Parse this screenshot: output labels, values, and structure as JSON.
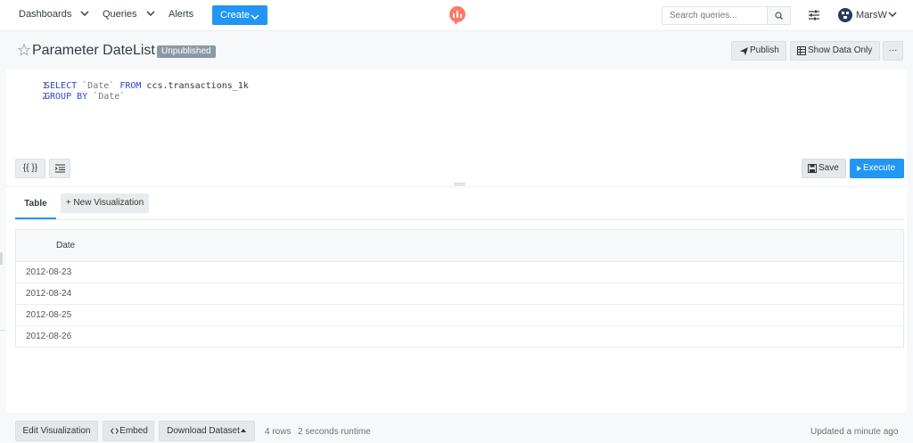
{
  "nav": {
    "dashboards": "Dashboards",
    "queries": "Queries",
    "alerts": "Alerts",
    "create": "Create",
    "search_placeholder": "Search queries...",
    "username": "MarsW"
  },
  "query": {
    "title": "Parameter DateList",
    "status_badge": "Unpublished",
    "publish_label": "Publish",
    "show_data_only_label": "Show Data Only",
    "more_label": "···"
  },
  "editor": {
    "lines": [
      {
        "num": "1",
        "tokens": [
          "SELECT",
          " ",
          "`Date`",
          " ",
          "FROM",
          " ccs.transactions_1k"
        ]
      },
      {
        "num": "2",
        "tokens": [
          "GROUP BY",
          " ",
          "`Date`"
        ]
      }
    ],
    "params_label": "{{ }}",
    "save_label": "Save",
    "execute_label": "Execute"
  },
  "results": {
    "tabs": [
      {
        "label": "Table"
      },
      {
        "label": "+ New Visualization"
      }
    ],
    "columns": [
      "Date"
    ],
    "rows": [
      "2012-08-23",
      "2012-08-24",
      "2012-08-25",
      "2012-08-26"
    ]
  },
  "footer": {
    "edit_visualization": "Edit Visualization",
    "embed": "Embed",
    "download_dataset": "Download Dataset",
    "row_count": "4 rows",
    "runtime": "2 seconds runtime",
    "updated": "Updated a minute ago"
  },
  "colors": {
    "accent": "#2196f3",
    "badge": "#8a9aa5",
    "logo": "#ff7964"
  }
}
